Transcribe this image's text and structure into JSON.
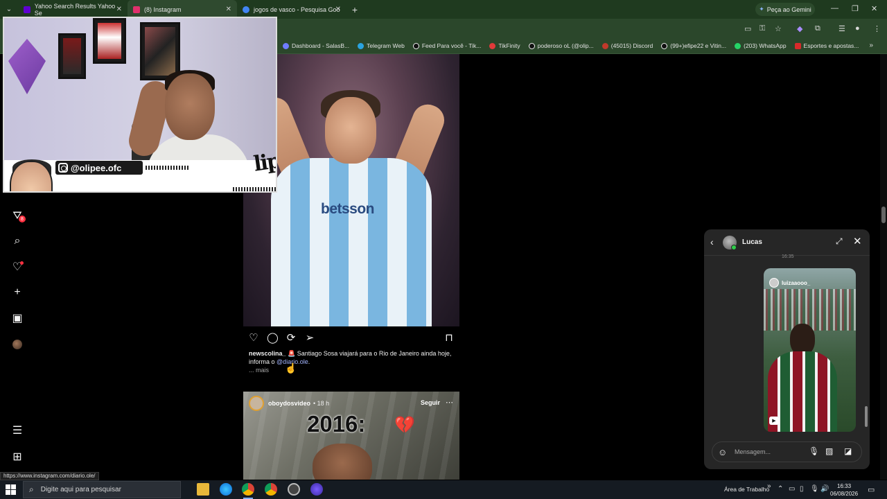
{
  "browser": {
    "tabs": [
      {
        "label": "Yahoo Search Results Yahoo Se",
        "favicon_color": "#5f01d1"
      },
      {
        "label": "(8) Instagram",
        "favicon_color": "#e1306c"
      },
      {
        "label": "jogos de vasco - Pesquisa Goo",
        "favicon_color": "#4285f4"
      }
    ],
    "new_tab": "+",
    "gemini_label": "Peça ao Gemini",
    "window_controls": [
      "—",
      "❐",
      "✕"
    ],
    "bookmarks": [
      {
        "label": "Dashboard - SalasB...",
        "color": "#6f7cff"
      },
      {
        "label": "Telegram Web",
        "color": "#2aa3e0"
      },
      {
        "label": "Feed Para você - Tik...",
        "color": "#111111"
      },
      {
        "label": "TikFinity",
        "color": "#e03a3a"
      },
      {
        "label": "poderoso oL (@olip...",
        "color": "#111111"
      },
      {
        "label": "(45015) Discord",
        "color": "#c0392b"
      },
      {
        "label": "(99+)efipe22 e Vitin...",
        "color": "#111111"
      },
      {
        "label": "(203) WhatsApp",
        "color": "#25d366"
      },
      {
        "label": "Esportes e apostas...",
        "color": "#d82a2a"
      }
    ],
    "status_url": "https://www.instagram.com/diario.ole/"
  },
  "webcam": {
    "handle": "@olipee.ofc",
    "signature": "lipe"
  },
  "sidebar": {
    "notification_count": "8"
  },
  "post1": {
    "jersey_sponsor": "betsson",
    "username": "newscolina_",
    "caption": "Santiago Sosa viajará para o Rio de Janeiro ainda hoje, informa o",
    "mention": "@diario.ole",
    "mention_suffix": ".",
    "more": "... mais"
  },
  "post2": {
    "username": "oboydosvideo",
    "time": "• 18 h",
    "follow": "Seguir",
    "overlay_text": "2016:",
    "overlay_emoji": "💔"
  },
  "chat": {
    "name": "Lucas",
    "timestamp": "16:35",
    "story_user": "luizaaooo_",
    "placeholder": "Mensagem..."
  },
  "taskbar": {
    "search_placeholder": "Digite aqui para pesquisar",
    "desktop_label": "Área de Trabalho",
    "time": "16:33",
    "date": "06/08/2026"
  }
}
